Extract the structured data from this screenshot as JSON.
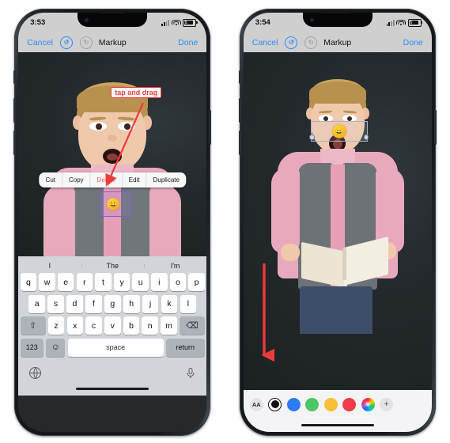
{
  "left_phone": {
    "status": {
      "time": "3:53",
      "battery_label": "5",
      "signal_icon": "cellular-signal-icon",
      "wifi_icon": "wifi-icon",
      "battery_icon": "battery-icon"
    },
    "toolbar": {
      "cancel_label": "Cancel",
      "title": "Markup",
      "done_label": "Done",
      "undo_icon": "undo-icon",
      "undo_glyph": "↺",
      "redo_icon": "redo-icon",
      "redo_glyph": "↻"
    },
    "context_menu": {
      "items": [
        {
          "label": "Cut",
          "style": "normal"
        },
        {
          "label": "Copy",
          "style": "normal"
        },
        {
          "label": "Delete",
          "style": "danger"
        },
        {
          "label": "Edit",
          "style": "normal"
        },
        {
          "label": "Duplicate",
          "style": "normal"
        }
      ]
    },
    "annotation": {
      "label": "tap and drag",
      "color": "#ef3b3b"
    },
    "sticker": {
      "glyph": "😀",
      "name": "emoji-sticker"
    },
    "keyboard": {
      "predictions": [
        "I",
        "The",
        "I'm"
      ],
      "row1": [
        "q",
        "w",
        "e",
        "r",
        "t",
        "y",
        "u",
        "i",
        "o",
        "p"
      ],
      "row2": [
        "a",
        "s",
        "d",
        "f",
        "g",
        "h",
        "j",
        "k",
        "l"
      ],
      "row3": [
        "z",
        "x",
        "c",
        "v",
        "b",
        "n",
        "m"
      ],
      "shift_glyph": "⇧",
      "delete_glyph": "⌫",
      "numbers_label": "123",
      "emoji_glyph": "☺",
      "space_label": "space",
      "return_label": "return",
      "globe_icon": "globe-icon",
      "mic_icon": "microphone-icon"
    }
  },
  "right_phone": {
    "status": {
      "time": "3:54",
      "battery_label": "5",
      "signal_icon": "cellular-signal-icon",
      "wifi_icon": "wifi-icon",
      "battery_icon": "battery-icon"
    },
    "toolbar": {
      "cancel_label": "Cancel",
      "title": "Markup",
      "done_label": "Done",
      "undo_icon": "undo-icon",
      "undo_glyph": "↺",
      "redo_icon": "redo-icon",
      "redo_glyph": "↻"
    },
    "sticker": {
      "glyph": "😀",
      "name": "emoji-sticker"
    },
    "annotation": {
      "arrow_color": "#ef3b3b",
      "points_to": "text-style-button"
    },
    "color_toolbar": {
      "text_style_label": "AA",
      "add_label": "+",
      "swatches": [
        {
          "name": "black",
          "color": "#111111",
          "selected": true
        },
        {
          "name": "blue",
          "color": "#2f7bf6",
          "selected": false
        },
        {
          "name": "green",
          "color": "#4cc764",
          "selected": false
        },
        {
          "name": "yellow",
          "color": "#f5c033",
          "selected": false
        },
        {
          "name": "red",
          "color": "#f23b4a",
          "selected": false
        },
        {
          "name": "color-wheel",
          "color": "rainbow",
          "selected": false
        }
      ]
    }
  },
  "theme": {
    "page_background": "#ffffff",
    "phone_frame": "#101214",
    "chrome_bar": "#cfcfcf",
    "accent_blue": "#2e8bff",
    "danger_red": "#e8585f",
    "annotation_red": "#ef3b3b",
    "keyboard_bg": "#d1d4d9",
    "photo_bg": "#22272a"
  }
}
